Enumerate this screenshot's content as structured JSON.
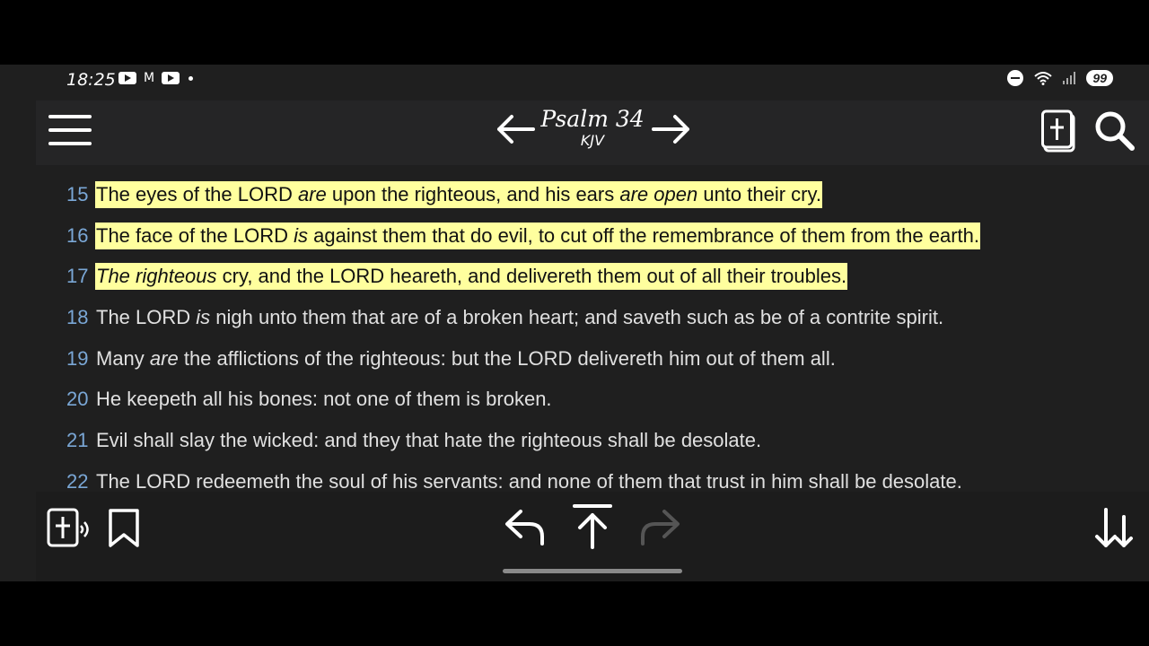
{
  "status_bar": {
    "time": "18:25",
    "battery": "99",
    "notif_icons": [
      "youtube-icon",
      "gmail-icon",
      "youtube-icon"
    ]
  },
  "header": {
    "title": "Psalm 34",
    "subtitle": "KJV"
  },
  "colors": {
    "highlight": "#ffff9e",
    "verse_number": "#7aa7d6",
    "background": "#1f1f1f"
  },
  "verses": [
    {
      "num": "15",
      "highlighted": true,
      "parts": [
        {
          "t": "The eyes of the LORD ",
          "i": false
        },
        {
          "t": "are",
          "i": true
        },
        {
          "t": " upon the righteous, and his ears ",
          "i": false
        },
        {
          "t": "are open",
          "i": true
        },
        {
          "t": " unto their cry.",
          "i": false
        }
      ]
    },
    {
      "num": "16",
      "highlighted": true,
      "parts": [
        {
          "t": "The face of the LORD ",
          "i": false
        },
        {
          "t": "is",
          "i": true
        },
        {
          "t": " against them that do evil, to cut off the remembrance of them from the earth.",
          "i": false
        }
      ]
    },
    {
      "num": "17",
      "highlighted": true,
      "parts": [
        {
          "t": "The righteous",
          "i": true
        },
        {
          "t": " cry, and the LORD heareth, and delivereth them out of all their troubles.",
          "i": false
        }
      ]
    },
    {
      "num": "18",
      "highlighted": false,
      "parts": [
        {
          "t": "The LORD ",
          "i": false
        },
        {
          "t": "is",
          "i": true
        },
        {
          "t": " nigh unto them that are of a broken heart; and saveth such as be of a contrite spirit.",
          "i": false
        }
      ]
    },
    {
      "num": "19",
      "highlighted": false,
      "parts": [
        {
          "t": "Many ",
          "i": false
        },
        {
          "t": "are",
          "i": true
        },
        {
          "t": " the afflictions of the righteous: but the LORD delivereth him out of them all.",
          "i": false
        }
      ]
    },
    {
      "num": "20",
      "highlighted": false,
      "parts": [
        {
          "t": "He keepeth all his bones: not one of them is broken.",
          "i": false
        }
      ]
    },
    {
      "num": "21",
      "highlighted": false,
      "parts": [
        {
          "t": "Evil shall slay the wicked: and they that hate the righteous shall be desolate.",
          "i": false
        }
      ]
    },
    {
      "num": "22",
      "highlighted": false,
      "parts": [
        {
          "t": "The LORD redeemeth the soul of his servants: and none of them that trust in him shall be desolate.",
          "i": false
        }
      ]
    }
  ],
  "toolbar": {
    "icons": [
      "audio-bible-icon",
      "bookmark-icon",
      "back-icon",
      "scroll-top-icon",
      "forward-icon",
      "scroll-down-icon"
    ]
  }
}
